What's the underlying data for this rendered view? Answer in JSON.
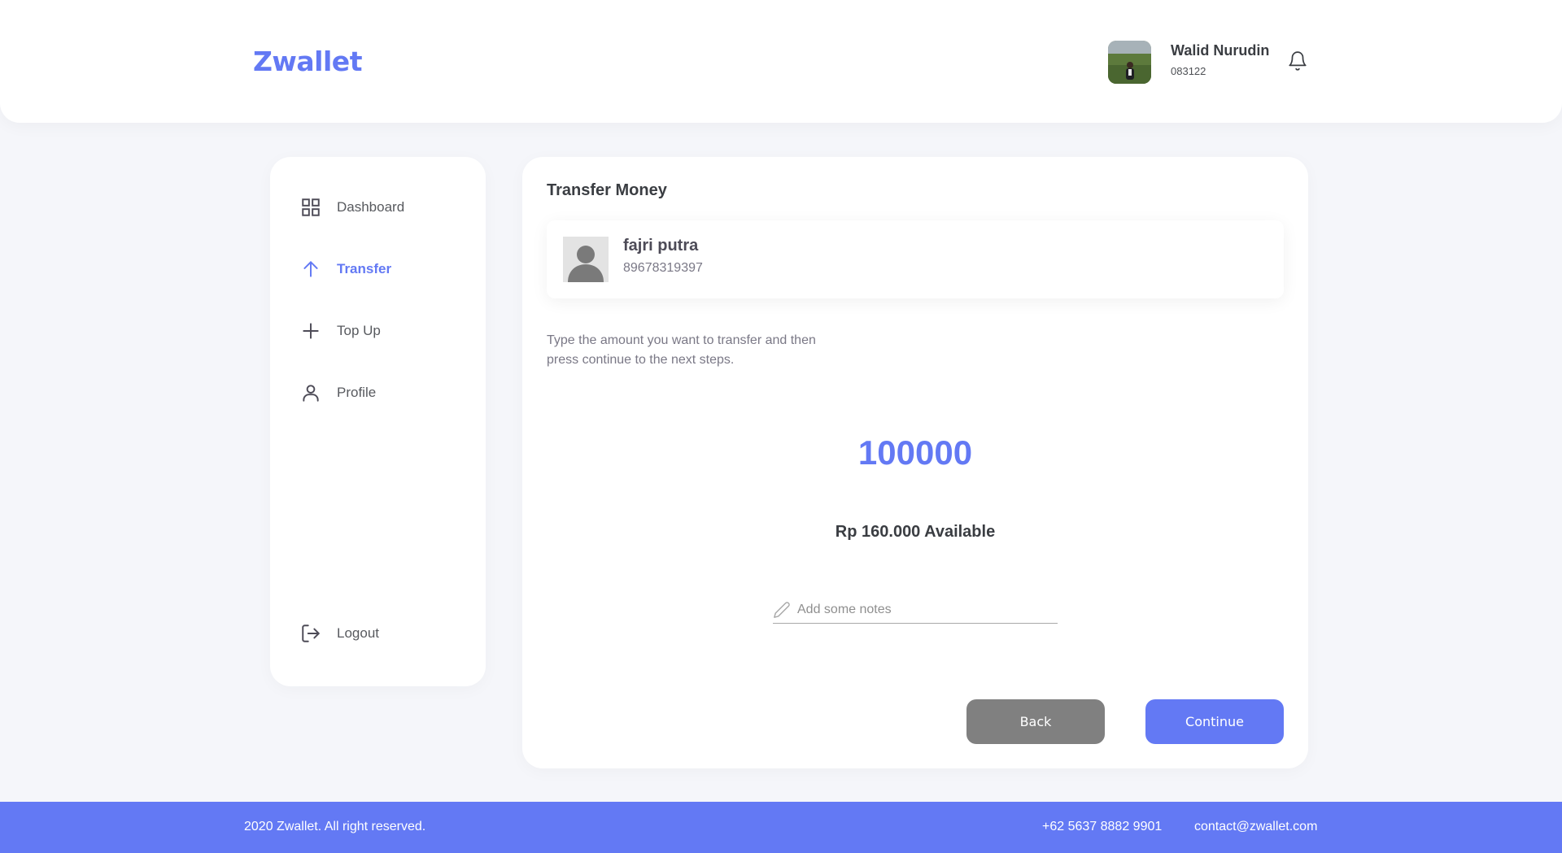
{
  "brand": "Zwallet",
  "user": {
    "name": "Walid Nurudin",
    "phone": "083122"
  },
  "sidebar": {
    "items": [
      {
        "label": "Dashboard",
        "icon": "grid-icon"
      },
      {
        "label": "Transfer",
        "icon": "arrow-up-icon",
        "active": true
      },
      {
        "label": "Top Up",
        "icon": "plus-icon"
      },
      {
        "label": "Profile",
        "icon": "user-icon"
      }
    ],
    "logout": {
      "label": "Logout",
      "icon": "logout-icon"
    }
  },
  "main": {
    "title": "Transfer Money",
    "recipient": {
      "name": "fajri putra",
      "phone": "89678319397"
    },
    "instructions": "Type the amount you want to transfer and then press continue to the next steps.",
    "amount": "100000",
    "available": "Rp 160.000 Available",
    "notes_placeholder": "Add some notes",
    "back_label": "Back",
    "continue_label": "Continue"
  },
  "footer": {
    "copyright": "2020 Zwallet. All right reserved.",
    "phone": "+62 5637 8882 9901",
    "email": "contact@zwallet.com"
  },
  "colors": {
    "accent": "#6379f4",
    "background": "#f5f6fa",
    "back_button": "#808080"
  }
}
